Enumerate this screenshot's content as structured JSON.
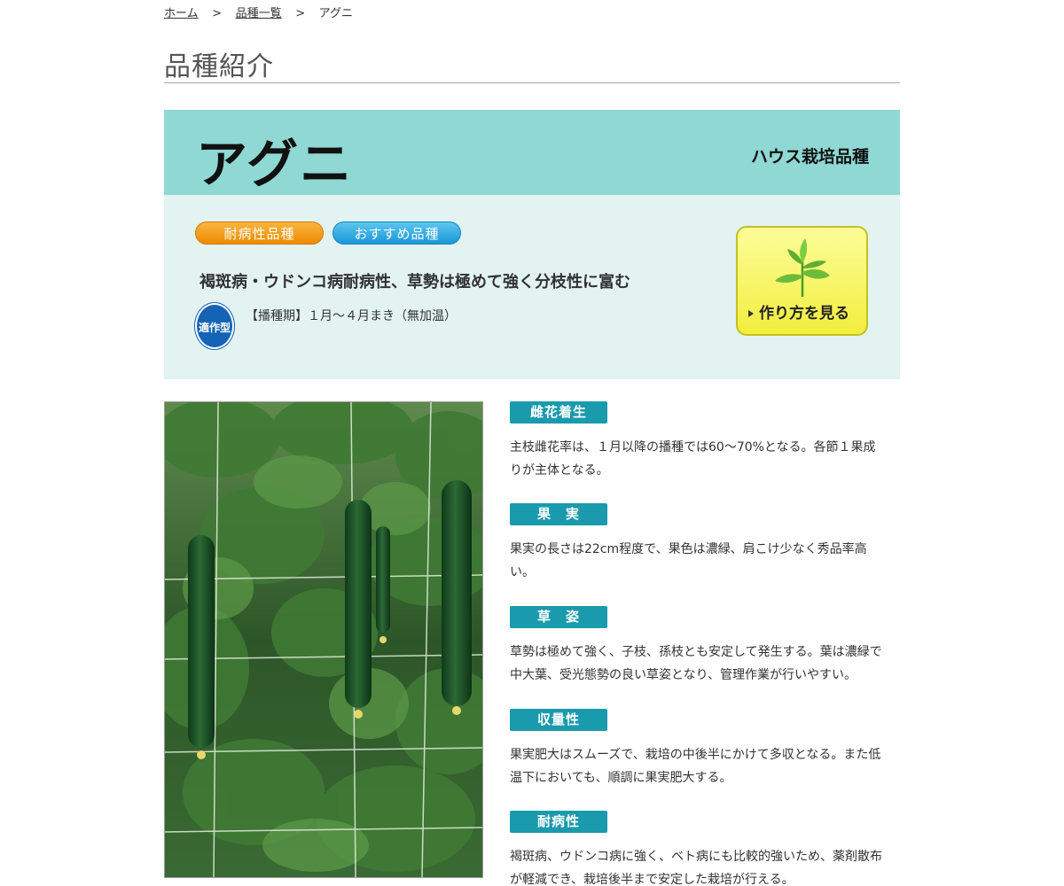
{
  "breadcrumb": {
    "home": "ホーム",
    "list": "品種一覧",
    "current": "アグニ",
    "separator": ">"
  },
  "page_title": "品種紹介",
  "variety": {
    "name": "アグニ",
    "type": "ハウス栽培品種"
  },
  "badges": {
    "disease_resistant": "耐病性品種",
    "recommended": "おすすめ品種"
  },
  "headline": "褐斑病・ウドンコ病耐病性、草勢は極めて強く分枝性に富む",
  "adapt_badge": "適作型",
  "sowing": "【播種期】１月〜４月まき（無加温）",
  "howto_button": "作り方を見る",
  "features": [
    {
      "label": "雌花着生",
      "text": "主枝雌花率は、１月以降の播種では60〜70%となる。各節１果成りが主体となる。"
    },
    {
      "label": "果　実",
      "text": "果実の長さは22cm程度で、果色は濃緑、肩こけ少なく秀品率高い。"
    },
    {
      "label": "草　姿",
      "text": "草勢は極めて強く、子枝、孫枝とも安定して発生する。葉は濃緑で中大葉、受光態勢の良い草姿となり、管理作業が行いやすい。"
    },
    {
      "label": "収量性",
      "text": "果実肥大はスムーズで、栽培の中後半にかけて多収となる。また低温下においても、順調に果実肥大する。"
    },
    {
      "label": "耐病性",
      "text": "褐斑病、ウドンコ病に強く、ベト病にも比較的強いため、薬剤散布が軽減でき、栽培後半まで安定した栽培が行える。"
    }
  ],
  "colors": {
    "header_band": "#8fd8d4",
    "info_panel": "#e2f3f2",
    "feature_label": "#1a9aad",
    "badge_orange": "#ee8a00",
    "badge_blue": "#1a97d6",
    "adapt_badge": "#1563b4",
    "howto_button": "#f1ee3e"
  }
}
